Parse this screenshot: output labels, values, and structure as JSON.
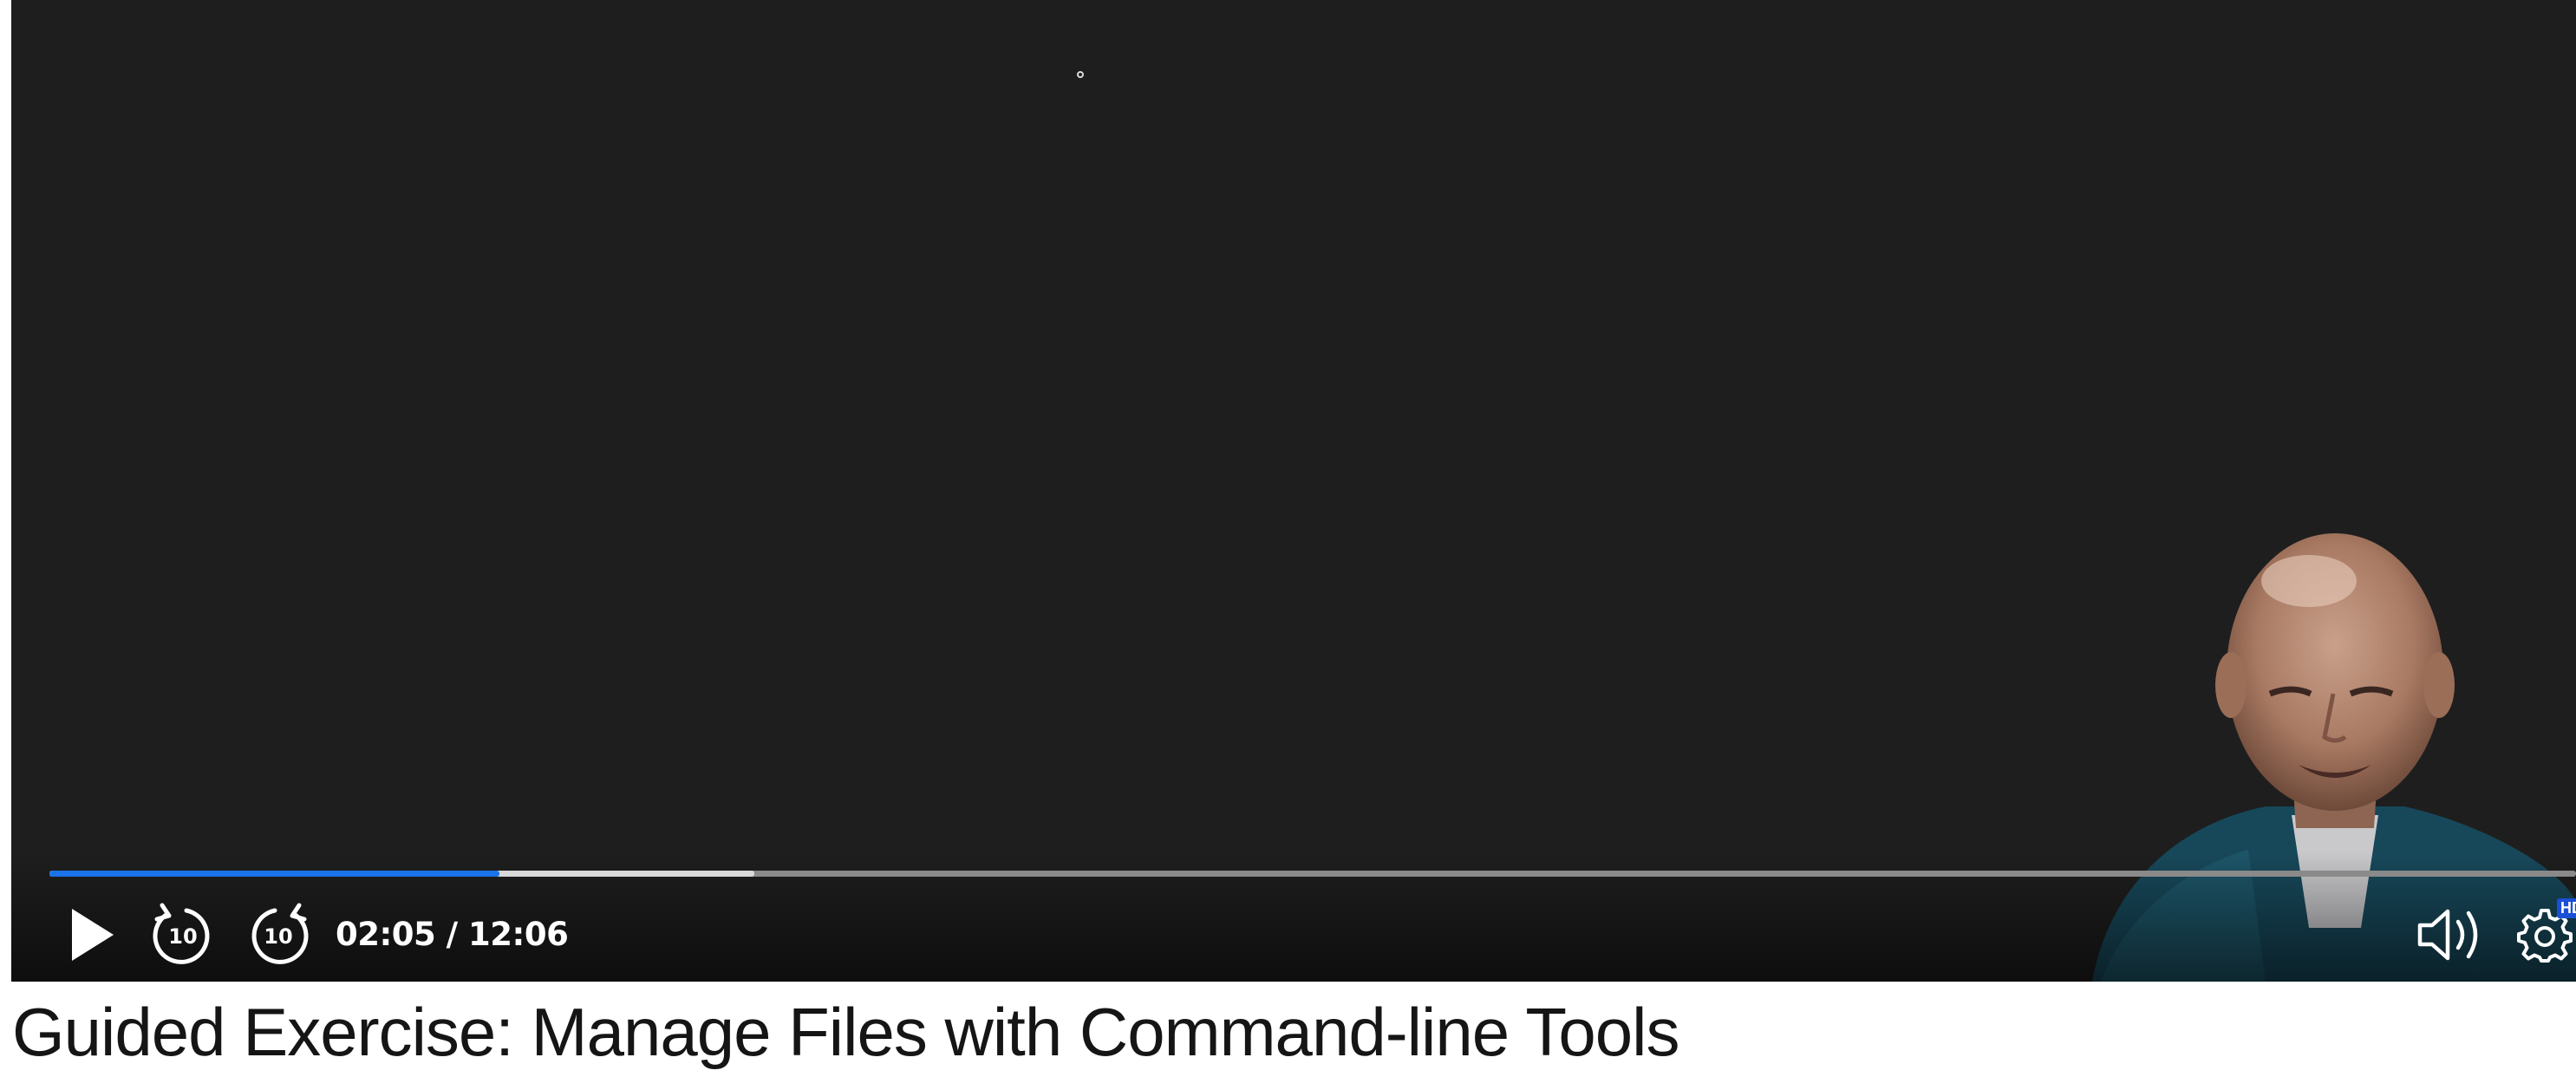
{
  "player": {
    "time_display": "02:05 / 12:06",
    "progress": {
      "played_fraction": 0.178,
      "buffered_fraction": 0.279
    },
    "rewind_seconds": "10",
    "forward_seconds": "10",
    "hd_badge": "HD",
    "icons": {
      "play": "play-icon",
      "rewind": "rewind-10-icon",
      "forward": "forward-10-icon",
      "volume": "volume-icon",
      "settings": "gear-icon"
    },
    "colors": {
      "played": "#1a73e8",
      "buffered": "#d8d8d8",
      "track": "#8a8a8a",
      "background": "#1e1e1e"
    }
  },
  "page": {
    "title": "Guided Exercise: Manage Files with Command-line Tools"
  }
}
